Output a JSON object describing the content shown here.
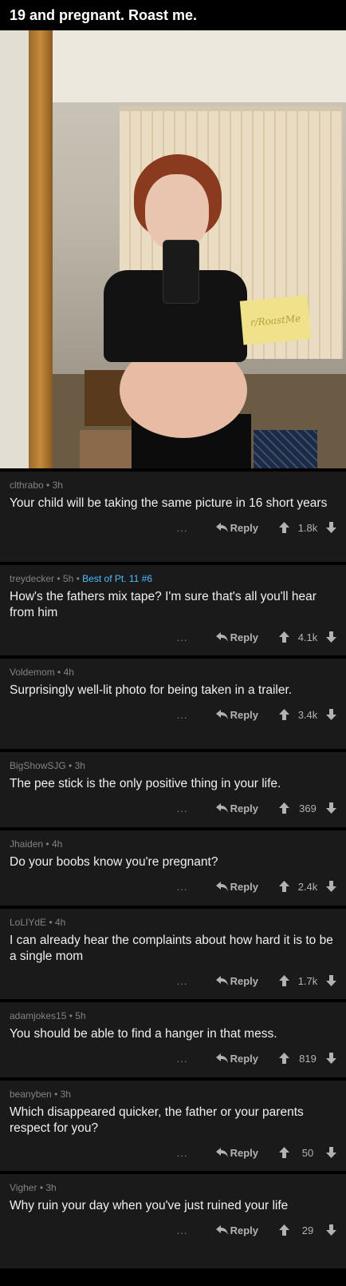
{
  "post": {
    "title": "19 and pregnant. Roast me."
  },
  "photo": {
    "sign_text": "r/RoastMe"
  },
  "ui": {
    "dots": "...",
    "reply_label": "Reply"
  },
  "comments": [
    {
      "user": "clthrabo",
      "age": "3h",
      "flair": "",
      "text": "Your child will be taking the same picture in 16 short years",
      "score": "1.8k"
    },
    {
      "user": "treydecker",
      "age": "5h",
      "flair": "Best of Pt. 11 #6",
      "text": "How's the fathers mix tape? I'm sure that's all you'll hear from him",
      "score": "4.1k"
    },
    {
      "user": "Voldemom",
      "age": "4h",
      "flair": "",
      "text": "Surprisingly well-lit photo for being taken in a trailer.",
      "score": "3.4k"
    },
    {
      "user": "BigShowSJG",
      "age": "3h",
      "flair": "",
      "text": "The pee stick is the only positive thing in your life.",
      "score": "369"
    },
    {
      "user": "Jhaiden",
      "age": "4h",
      "flair": "",
      "text": "Do your boobs know you're pregnant?",
      "score": "2.4k"
    },
    {
      "user": "LoLIYdE",
      "age": "4h",
      "flair": "",
      "text": "I can already hear the complaints about how hard it is to be a single mom",
      "score": "1.7k"
    },
    {
      "user": "adamjokes15",
      "age": "5h",
      "flair": "",
      "text": "You should be able to find a hanger in that mess.",
      "score": "819"
    },
    {
      "user": "beanyben",
      "age": "3h",
      "flair": "",
      "text": "Which disappeared quicker, the father or your parents respect for you?",
      "score": "50"
    },
    {
      "user": "Vigher",
      "age": "3h",
      "flair": "",
      "text": "Why ruin your day when you've just ruined your life",
      "score": "29"
    }
  ]
}
